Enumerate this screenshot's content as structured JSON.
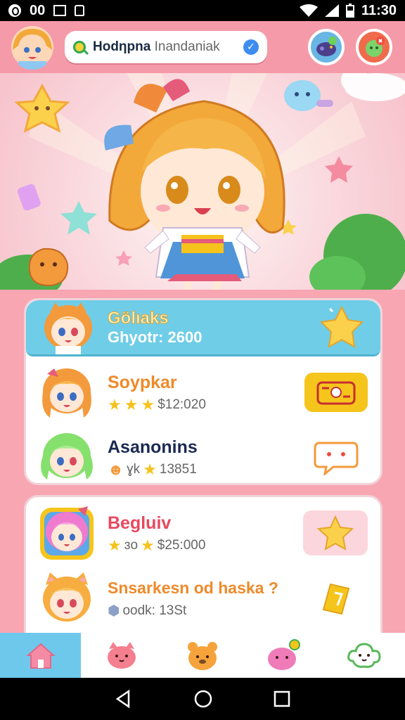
{
  "status_bar": {
    "notif_count": "00",
    "time": "11:30"
  },
  "header": {
    "search_bold": "Ηodηpna",
    "search_rest": "Inandaniak",
    "check_icon": "check-badge-icon",
    "buttons": [
      "controller-icon",
      "gift-icon"
    ]
  },
  "featured": {
    "title": "Gölıaks",
    "subtitle": "Ghyotr: 2600"
  },
  "list_card_1": [
    {
      "name": "Soypkar",
      "name_color": "#ee8a2a",
      "stat": "$12:020",
      "stars": 3,
      "action_icon": "sticker-badge-icon",
      "action_color": "#f6c51c",
      "hair_color": "#f39a3c"
    },
    {
      "name": "Asanonins",
      "name_color": "#1b2a52",
      "stat": "13851",
      "stars": 1,
      "stat_prefix": "ɣk",
      "action_icon": "chat-bubble-icon",
      "action_color": "#ffffff",
      "hair_color": "#86e06d"
    }
  ],
  "list_card_2": [
    {
      "name": "Begluiv",
      "name_color": "#e8485f",
      "stat": "$25:000",
      "stat_prefix": "ɜo",
      "stars": 2,
      "action_icon": "star-icon",
      "action_color": "#fbd6dd",
      "hair_color": "#ef7bcf"
    },
    {
      "name": "Snsarkesn od haska ?",
      "name_color": "#ee8a2a",
      "stat": "oodk: 13St",
      "action_icon": "ticket-icon",
      "action_color": "#ffffff",
      "hair_color": "#f7ad3f"
    }
  ],
  "bottom_nav": [
    {
      "icon": "home-icon",
      "active": true
    },
    {
      "icon": "cat-face-icon",
      "active": false
    },
    {
      "icon": "bear-face-icon",
      "active": false
    },
    {
      "icon": "pink-monster-icon",
      "active": false
    },
    {
      "icon": "cloud-face-icon",
      "active": false
    }
  ],
  "colors": {
    "header_bg": "#f59aa8",
    "accent_blue": "#6fcde7",
    "star_yellow": "#f6c31d"
  }
}
